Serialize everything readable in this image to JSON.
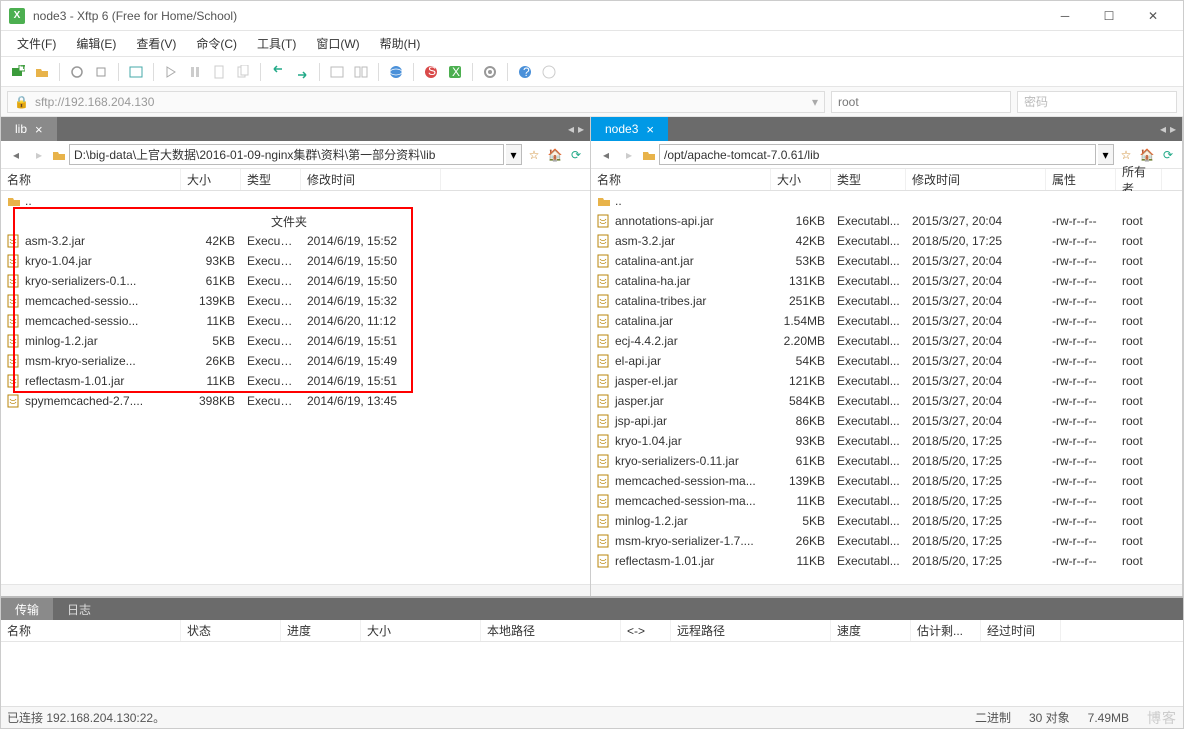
{
  "window": {
    "title": "node3    - Xftp 6 (Free for Home/School)"
  },
  "menu": {
    "file": "文件(F)",
    "edit": "编辑(E)",
    "view": "查看(V)",
    "cmd": "命令(C)",
    "tool": "工具(T)",
    "window": "窗口(W)",
    "help": "帮助(H)"
  },
  "connect": {
    "addr": "sftp://192.168.204.130",
    "user": "root",
    "pass_placeholder": "密码"
  },
  "left_tab": {
    "label": "lib"
  },
  "right_tab": {
    "label": "node3"
  },
  "left_path": "D:\\big-data\\上官大数据\\2016-01-09-nginx集群\\资料\\第一部分资料\\lib",
  "right_path": "/opt/apache-tomcat-7.0.61/lib",
  "columns": {
    "name": "名称",
    "size": "大小",
    "type": "类型",
    "modified": "修改时间",
    "attr": "属性",
    "owner": "所有者",
    "folder": "文件夹"
  },
  "left_files": [
    {
      "name": "asm-3.2.jar",
      "size": "42KB",
      "type": "Executabl...",
      "mod": "2014/6/19, 15:52"
    },
    {
      "name": "kryo-1.04.jar",
      "size": "93KB",
      "type": "Executabl...",
      "mod": "2014/6/19, 15:50"
    },
    {
      "name": "kryo-serializers-0.1...",
      "size": "61KB",
      "type": "Executabl...",
      "mod": "2014/6/19, 15:50"
    },
    {
      "name": "memcached-sessio...",
      "size": "139KB",
      "type": "Executabl...",
      "mod": "2014/6/19, 15:32"
    },
    {
      "name": "memcached-sessio...",
      "size": "11KB",
      "type": "Executabl...",
      "mod": "2014/6/20, 11:12"
    },
    {
      "name": "minlog-1.2.jar",
      "size": "5KB",
      "type": "Executabl...",
      "mod": "2014/6/19, 15:51"
    },
    {
      "name": "msm-kryo-serialize...",
      "size": "26KB",
      "type": "Executabl...",
      "mod": "2014/6/19, 15:49"
    },
    {
      "name": "reflectasm-1.01.jar",
      "size": "11KB",
      "type": "Executabl...",
      "mod": "2014/6/19, 15:51"
    },
    {
      "name": "spymemcached-2.7....",
      "size": "398KB",
      "type": "Executabl...",
      "mod": "2014/6/19, 13:45"
    }
  ],
  "right_files": [
    {
      "name": "annotations-api.jar",
      "size": "16KB",
      "type": "Executabl...",
      "mod": "2015/3/27, 20:04",
      "attr": "-rw-r--r--",
      "own": "root"
    },
    {
      "name": "asm-3.2.jar",
      "size": "42KB",
      "type": "Executabl...",
      "mod": "2018/5/20, 17:25",
      "attr": "-rw-r--r--",
      "own": "root"
    },
    {
      "name": "catalina-ant.jar",
      "size": "53KB",
      "type": "Executabl...",
      "mod": "2015/3/27, 20:04",
      "attr": "-rw-r--r--",
      "own": "root"
    },
    {
      "name": "catalina-ha.jar",
      "size": "131KB",
      "type": "Executabl...",
      "mod": "2015/3/27, 20:04",
      "attr": "-rw-r--r--",
      "own": "root"
    },
    {
      "name": "catalina-tribes.jar",
      "size": "251KB",
      "type": "Executabl...",
      "mod": "2015/3/27, 20:04",
      "attr": "-rw-r--r--",
      "own": "root"
    },
    {
      "name": "catalina.jar",
      "size": "1.54MB",
      "type": "Executabl...",
      "mod": "2015/3/27, 20:04",
      "attr": "-rw-r--r--",
      "own": "root"
    },
    {
      "name": "ecj-4.4.2.jar",
      "size": "2.20MB",
      "type": "Executabl...",
      "mod": "2015/3/27, 20:04",
      "attr": "-rw-r--r--",
      "own": "root"
    },
    {
      "name": "el-api.jar",
      "size": "54KB",
      "type": "Executabl...",
      "mod": "2015/3/27, 20:04",
      "attr": "-rw-r--r--",
      "own": "root"
    },
    {
      "name": "jasper-el.jar",
      "size": "121KB",
      "type": "Executabl...",
      "mod": "2015/3/27, 20:04",
      "attr": "-rw-r--r--",
      "own": "root"
    },
    {
      "name": "jasper.jar",
      "size": "584KB",
      "type": "Executabl...",
      "mod": "2015/3/27, 20:04",
      "attr": "-rw-r--r--",
      "own": "root"
    },
    {
      "name": "jsp-api.jar",
      "size": "86KB",
      "type": "Executabl...",
      "mod": "2015/3/27, 20:04",
      "attr": "-rw-r--r--",
      "own": "root"
    },
    {
      "name": "kryo-1.04.jar",
      "size": "93KB",
      "type": "Executabl...",
      "mod": "2018/5/20, 17:25",
      "attr": "-rw-r--r--",
      "own": "root"
    },
    {
      "name": "kryo-serializers-0.11.jar",
      "size": "61KB",
      "type": "Executabl...",
      "mod": "2018/5/20, 17:25",
      "attr": "-rw-r--r--",
      "own": "root"
    },
    {
      "name": "memcached-session-ma...",
      "size": "139KB",
      "type": "Executabl...",
      "mod": "2018/5/20, 17:25",
      "attr": "-rw-r--r--",
      "own": "root"
    },
    {
      "name": "memcached-session-ma...",
      "size": "11KB",
      "type": "Executabl...",
      "mod": "2018/5/20, 17:25",
      "attr": "-rw-r--r--",
      "own": "root"
    },
    {
      "name": "minlog-1.2.jar",
      "size": "5KB",
      "type": "Executabl...",
      "mod": "2018/5/20, 17:25",
      "attr": "-rw-r--r--",
      "own": "root"
    },
    {
      "name": "msm-kryo-serializer-1.7....",
      "size": "26KB",
      "type": "Executabl...",
      "mod": "2018/5/20, 17:25",
      "attr": "-rw-r--r--",
      "own": "root"
    },
    {
      "name": "reflectasm-1.01.jar",
      "size": "11KB",
      "type": "Executabl...",
      "mod": "2018/5/20, 17:25",
      "attr": "-rw-r--r--",
      "own": "root"
    }
  ],
  "transfer": {
    "tab_transfer": "传输",
    "tab_log": "日志",
    "cols": {
      "name": "名称",
      "status": "状态",
      "progress": "进度",
      "size": "大小",
      "local": "本地路径",
      "sep": "<->",
      "remote": "远程路径",
      "speed": "速度",
      "eta": "估计剩...",
      "elapsed": "经过时间"
    }
  },
  "status": {
    "conn": "已连接 192.168.204.130:22。",
    "mode": "二进制",
    "objects": "30 对象",
    "size": "7.49MB",
    "watermark": "博客"
  }
}
